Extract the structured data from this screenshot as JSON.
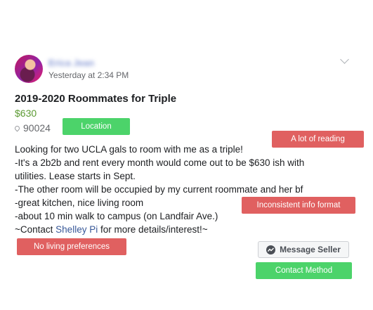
{
  "post": {
    "author_name": "Erica Jean",
    "timestamp": "Yesterday at 2:34 PM",
    "title": "2019-2020 Roommates for Triple",
    "price": "$630",
    "zip": "90024",
    "description": {
      "line1": "Looking for two UCLA gals to room with me as a triple!",
      "line2": "-It's a 2b2b and rent every month would come out to be $630 ish with",
      "line3": "utilities. Lease starts in Sept.",
      "line4": "-The other room will be occupied by my current roommate and her bf",
      "line5": "-great kitchen, nice living room",
      "line6": "-about 10 min walk to campus (on Landfair Ave.)",
      "line7_prefix": "~Contact ",
      "line7_link": "Shelley Pi",
      "line7_suffix": " for more details/interest!~"
    },
    "message_button": "Message Seller"
  },
  "annotations": {
    "location": "Location",
    "a_lot_of_reading": "A lot of reading",
    "inconsistent_info_format": "Inconsistent info format",
    "no_living_preferences": "No living preferences",
    "contact_method": "Contact Method"
  },
  "colors": {
    "tag_red": "#e06060",
    "tag_green": "#4cd36a",
    "price_green": "#5b9a32",
    "link_blue": "#385898"
  },
  "icons": {
    "location": "map-pin-icon",
    "messenger": "messenger-icon",
    "menu": "chevron-down-icon"
  }
}
